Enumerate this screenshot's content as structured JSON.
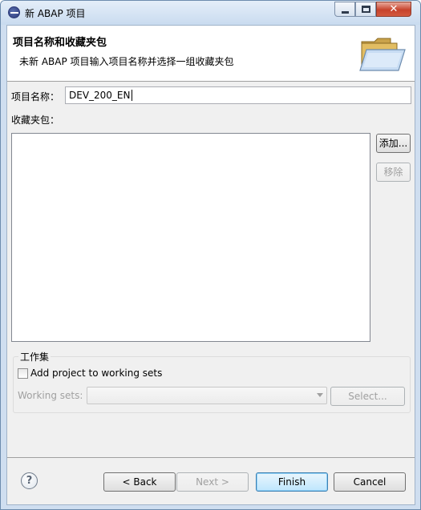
{
  "window": {
    "title": "新 ABAP 项目"
  },
  "header": {
    "title": "项目名称和收藏夹包",
    "description": "未新 ABAP 项目输入项目名称并选择一组收藏夹包"
  },
  "form": {
    "project_name_label": "项目名称：",
    "project_name_value": "DEV_200_EN",
    "favorites_label": "收藏夹包：",
    "add_button": "添加...",
    "remove_button": "移除"
  },
  "working_sets": {
    "group_title": "工作集",
    "checkbox_label": "Add project to working sets",
    "checkbox_checked": false,
    "sets_label": "Working sets:",
    "combo_value": "",
    "select_button": "Select..."
  },
  "footer": {
    "help_glyph": "?",
    "back_button": "< Back",
    "next_button": "Next >",
    "finish_button": "Finish",
    "cancel_button": "Cancel"
  },
  "colors": {
    "frame": "#cfdef0",
    "focus_border": "#3c7fb1",
    "disabled_text": "#a0a0a0"
  }
}
